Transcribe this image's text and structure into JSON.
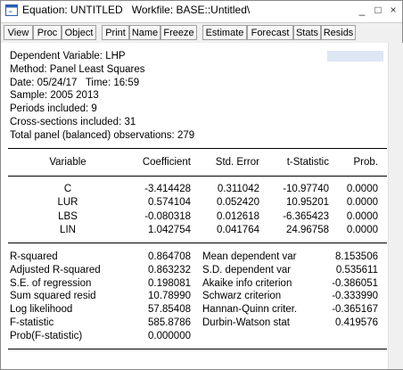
{
  "window": {
    "title": "Equation: UNTITLED   Workfile: BASE::Untitled\\",
    "controls": {
      "minimize": "_",
      "restore": "□",
      "close": "×"
    }
  },
  "toolbar": {
    "buttons": [
      "View",
      "Proc",
      "Object",
      "Print",
      "Name",
      "Freeze",
      "Estimate",
      "Forecast",
      "Stats",
      "Resids"
    ]
  },
  "header": {
    "dependent": "Dependent Variable: LHP",
    "method": "Method: Panel Least Squares",
    "date": "Date: 05/24/17   Time: 16:59",
    "sample": "Sample: 2005 2013",
    "periods": "Periods included: 9",
    "cross_sections": "Cross-sections included: 31",
    "observations": "Total panel (balanced) observations: 279"
  },
  "coef_table": {
    "columns": [
      "Variable",
      "Coefficient",
      "Std. Error",
      "t-Statistic",
      "Prob."
    ],
    "rows": [
      [
        "C",
        "-3.414428",
        "0.311042",
        "-10.97740",
        "0.0000"
      ],
      [
        "LUR",
        "0.574104",
        "0.052420",
        "10.95201",
        "0.0000"
      ],
      [
        "LBS",
        "-0.080318",
        "0.012618",
        "-6.365423",
        "0.0000"
      ],
      [
        "LIN",
        "1.042754",
        "0.041764",
        "24.96758",
        "0.0000"
      ]
    ]
  },
  "stats": {
    "left": [
      [
        "R-squared",
        "0.864708"
      ],
      [
        "Adjusted R-squared",
        "0.863232"
      ],
      [
        "S.E. of regression",
        "0.198081"
      ],
      [
        "Sum squared resid",
        "10.78990"
      ],
      [
        "Log likelihood",
        "57.85408"
      ],
      [
        "F-statistic",
        "585.8786"
      ],
      [
        "Prob(F-statistic)",
        "0.000000"
      ]
    ],
    "right": [
      [
        "Mean dependent var",
        "8.153506"
      ],
      [
        "S.D. dependent var",
        "0.535611"
      ],
      [
        "Akaike info criterion",
        "-0.386051"
      ],
      [
        "Schwarz criterion",
        "-0.333990"
      ],
      [
        "Hannan-Quinn criter.",
        "-0.365167"
      ],
      [
        "Durbin-Watson stat",
        "0.419576"
      ]
    ]
  }
}
